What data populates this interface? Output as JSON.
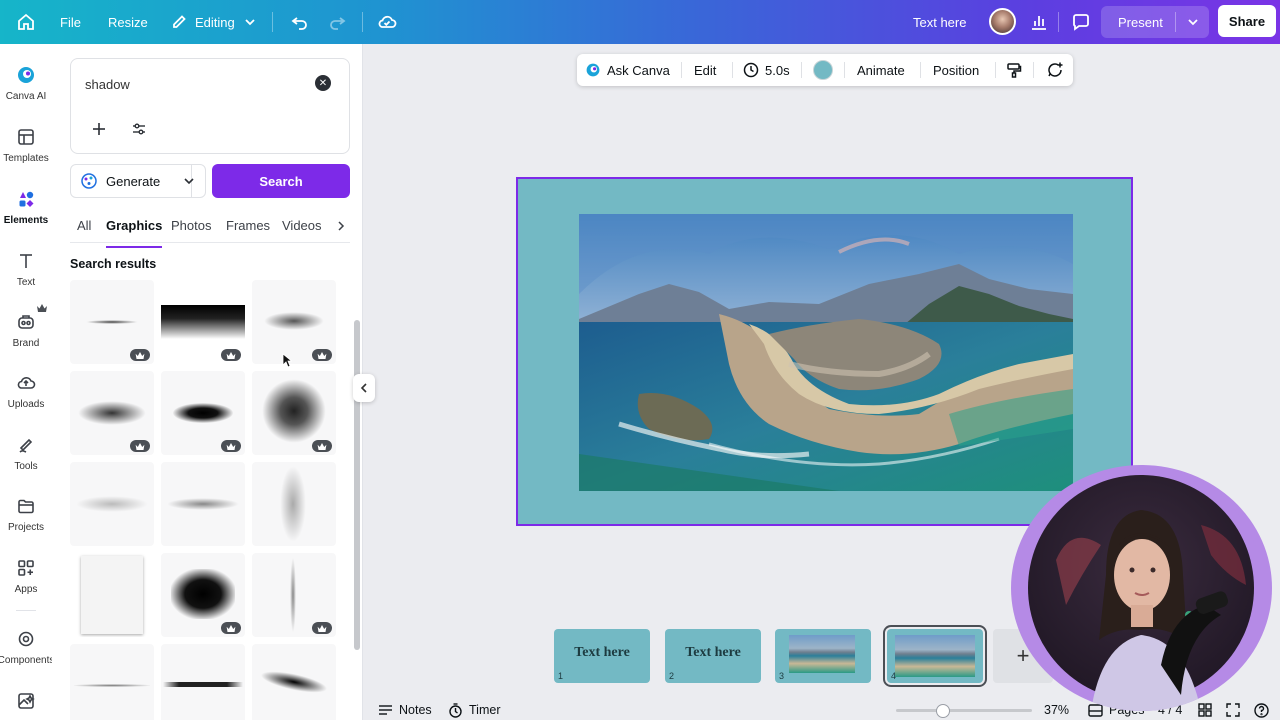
{
  "topbar": {
    "file": "File",
    "resize": "Resize",
    "editing": "Editing",
    "design_title": "Text here",
    "present": "Present",
    "share": "Share"
  },
  "rail": {
    "items": [
      {
        "label": "Canva AI",
        "icon": "canva-ai-icon"
      },
      {
        "label": "Templates",
        "icon": "templates-icon"
      },
      {
        "label": "Elements",
        "icon": "elements-icon"
      },
      {
        "label": "Text",
        "icon": "text-icon"
      },
      {
        "label": "Brand",
        "icon": "brand-icon"
      },
      {
        "label": "Uploads",
        "icon": "uploads-icon"
      },
      {
        "label": "Tools",
        "icon": "tools-icon"
      },
      {
        "label": "Projects",
        "icon": "projects-icon"
      },
      {
        "label": "Apps",
        "icon": "apps-icon"
      },
      {
        "label": "Components",
        "icon": "components-icon"
      }
    ]
  },
  "panel": {
    "search_value": "shadow",
    "generate": "Generate",
    "search": "Search",
    "tabs": [
      "All",
      "Graphics",
      "Photos",
      "Frames",
      "Videos"
    ],
    "active_tab": "Graphics",
    "results_title": "Search results"
  },
  "float_toolbar": {
    "ask_canva": "Ask Canva",
    "edit": "Edit",
    "duration": "5.0s",
    "animate": "Animate",
    "position": "Position",
    "swatch_color": "#73b9c4"
  },
  "pages": [
    {
      "num": "1",
      "title": "Text here"
    },
    {
      "num": "2",
      "title": "Text here"
    },
    {
      "num": "3",
      "title": ""
    },
    {
      "num": "4",
      "title": ""
    }
  ],
  "bottombar": {
    "notes": "Notes",
    "timer": "Timer",
    "zoom": "37%",
    "pages_label": "Pages",
    "pages_count": "4 / 4",
    "zoom_level": 0.3
  },
  "colors": {
    "accent": "#7d2ae8",
    "slide_bg": "#73b9c4"
  }
}
